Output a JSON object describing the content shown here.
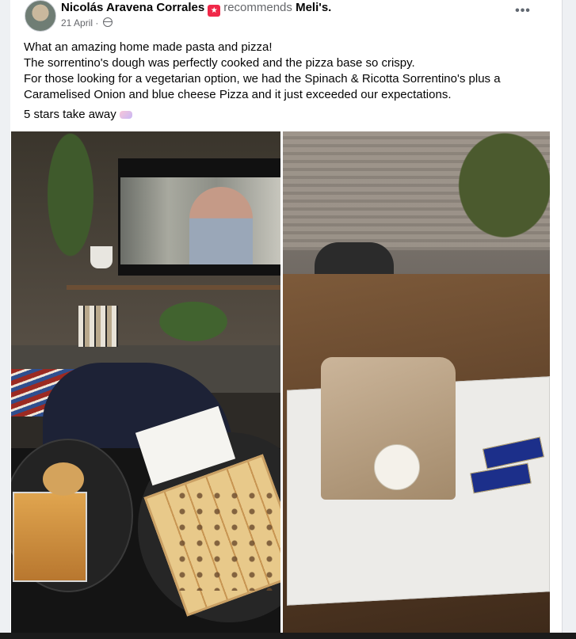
{
  "post": {
    "author": "Nicolás Aravena Corrales",
    "verb": "recommends",
    "page": "Meli's.",
    "date": "21 April",
    "more_label": "•••",
    "body_lines": [
      "What an amazing home made pasta and pizza!",
      "The sorrentino's dough was perfectly cooked and the pizza base so crispy.",
      "For those looking for a vegetarian option, we had the Spinach & Ricotta Sorrentino's plus a",
      "Caramelised Onion and blue cheese Pizza and it just exceeded our expectations."
    ],
    "rating_text": "5 stars take away"
  },
  "photos": {
    "left_alt": "Pasta and pizza in front of TV",
    "right_alt": "Take away bag and pizza box with chocolates"
  },
  "icons": {
    "badge": "recommends-badge-icon",
    "globe": "globe-icon",
    "more": "more-options-icon"
  }
}
